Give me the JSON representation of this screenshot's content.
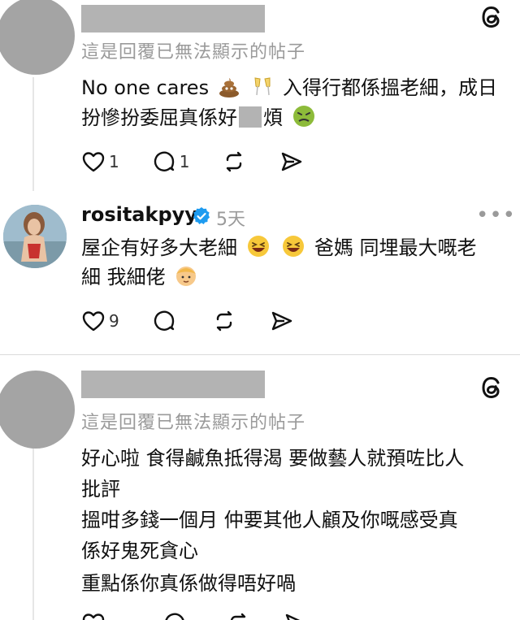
{
  "posts": [
    {
      "notice": "這是回覆已無法顯示的帖子",
      "lines": [
        "No one cares",
        "入得行都係搵老細，成日",
        "扮慘扮委屈真係好",
        "煩"
      ],
      "likes": "1",
      "comments": "1"
    },
    {
      "username": "rositakpyy",
      "time": "5天",
      "more": "•••",
      "lines": [
        "屋企有好多大老細",
        "爸媽 同埋最大嘅老",
        "細 我細佬"
      ],
      "likes": "9"
    },
    {
      "notice": "這是回覆已無法顯示的帖子",
      "lines": [
        "好心啦 食得鹹魚抵得渴 要做藝人就預咗比人",
        "批評",
        "搵咁多錢一個月 仲要其他人顧及你嘅感受真",
        "係好鬼死貪心",
        "重點係你真係做得唔好喎"
      ]
    }
  ],
  "colors": {
    "verified": "#1d9bf0",
    "muted": "#9a9a9a",
    "redacted": "#b3b3b3"
  },
  "icons": [
    "heart-icon",
    "comment-icon",
    "repost-icon",
    "share-icon",
    "threads-logo-icon",
    "verified-badge-icon"
  ]
}
